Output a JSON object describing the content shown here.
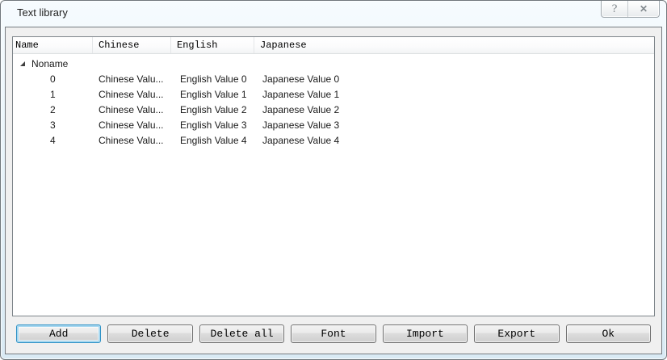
{
  "window": {
    "title": "Text library",
    "help_glyph": "?",
    "close_glyph": "✕"
  },
  "list": {
    "columns": {
      "name": "Name",
      "chinese": "Chinese",
      "english": "English",
      "japanese": "Japanese"
    },
    "group_label": "Noname",
    "rows": [
      {
        "name": "0",
        "chinese": "Chinese Valu...",
        "english": "English Value 0",
        "japanese": "Japanese Value 0"
      },
      {
        "name": "1",
        "chinese": "Chinese Valu...",
        "english": "English Value 1",
        "japanese": "Japanese Value 1"
      },
      {
        "name": "2",
        "chinese": "Chinese Valu...",
        "english": "English Value 2",
        "japanese": "Japanese Value 2"
      },
      {
        "name": "3",
        "chinese": "Chinese Valu...",
        "english": "English Value 3",
        "japanese": "Japanese Value 3"
      },
      {
        "name": "4",
        "chinese": "Chinese Valu...",
        "english": "English Value 4",
        "japanese": "Japanese Value 4"
      }
    ]
  },
  "buttons": {
    "add": "Add",
    "delete": "Delete",
    "delete_all": "Delete all",
    "font": "Font",
    "import": "Import",
    "export": "Export",
    "ok": "Ok"
  },
  "colors": {
    "panel": "#f0f0f0",
    "focus_ring": "#2f92c6",
    "frame_glass": "#d9eaf4"
  }
}
